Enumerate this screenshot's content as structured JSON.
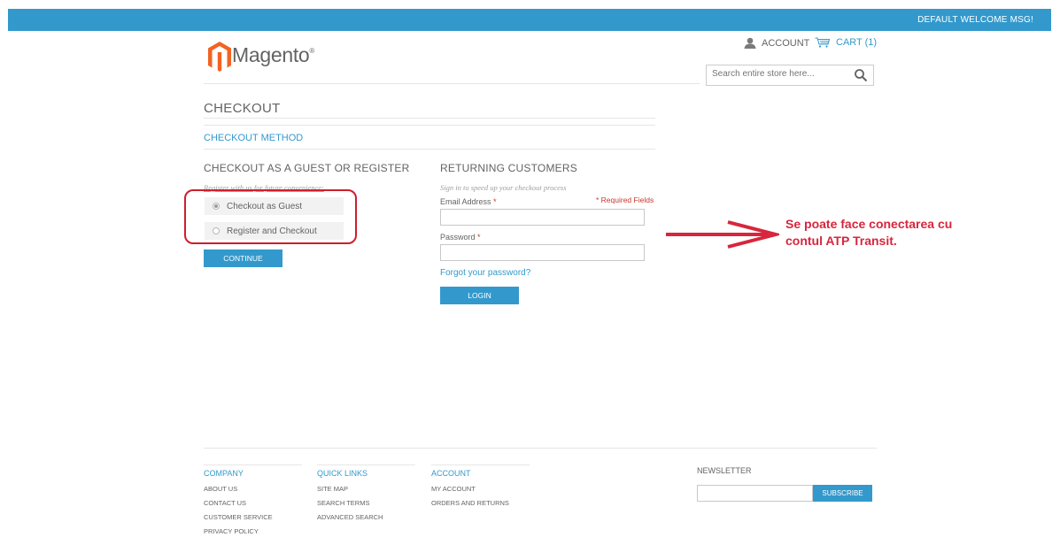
{
  "topbar": {
    "welcome": "DEFAULT WELCOME MSG!"
  },
  "header": {
    "logo_text": "Magento",
    "logo_mark": "®",
    "account_label": "ACCOUNT",
    "cart_label": "CART (1)",
    "search_placeholder": "Search entire store here..."
  },
  "checkout": {
    "title": "CHECKOUT",
    "step_title": "CHECKOUT METHOD",
    "guest": {
      "heading": "CHECKOUT AS A GUEST OR REGISTER",
      "subtitle": "Register with us for future convenience:",
      "options": [
        {
          "label": "Checkout as Guest",
          "checked": true
        },
        {
          "label": "Register and Checkout",
          "checked": false
        }
      ],
      "continue_label": "CONTINUE"
    },
    "returning": {
      "heading": "RETURNING CUSTOMERS",
      "subtitle": "Sign in to speed up your checkout process",
      "required_note": "* Required Fields",
      "email_label": "Email Address",
      "password_label": "Password",
      "required_star": "*",
      "forgot_label": "Forgot your password?",
      "login_label": "LOGIN"
    }
  },
  "annotation": {
    "line1": "Se poate face conectarea cu",
    "line2": "contul ATP Transit.",
    "color": "#d7263d"
  },
  "footer": {
    "columns": [
      {
        "title": "COMPANY",
        "items": [
          "ABOUT US",
          "CONTACT US",
          "CUSTOMER SERVICE",
          "PRIVACY POLICY"
        ]
      },
      {
        "title": "QUICK LINKS",
        "items": [
          "SITE MAP",
          "SEARCH TERMS",
          "ADVANCED SEARCH"
        ]
      },
      {
        "title": "ACCOUNT",
        "items": [
          "MY ACCOUNT",
          "ORDERS AND RETURNS"
        ]
      }
    ],
    "newsletter_title": "NEWSLETTER",
    "subscribe_label": "SUBSCRIBE"
  },
  "colors": {
    "accent": "#3399cc",
    "highlight": "#cc1f2d",
    "logo": "#f26322"
  },
  "icons": {
    "account": "user-icon",
    "cart": "cart-icon",
    "search": "search-icon",
    "logo": "magento-logo-icon",
    "arrow": "arrow-right-icon"
  }
}
